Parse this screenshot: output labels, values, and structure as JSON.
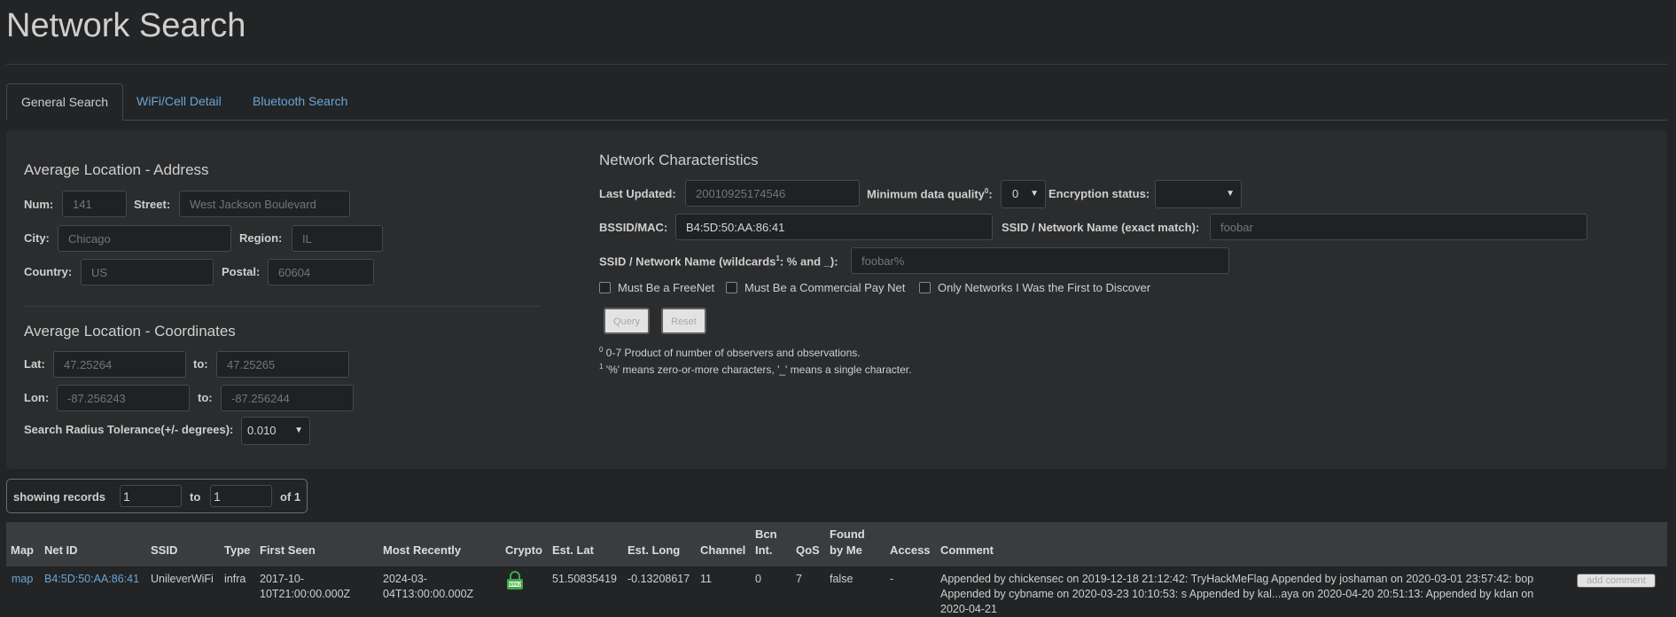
{
  "title": "Network Search",
  "tabs": [
    {
      "label": "General Search"
    },
    {
      "label": "WiFi/Cell Detail"
    },
    {
      "label": "Bluetooth Search"
    }
  ],
  "address": {
    "heading": "Average Location - Address",
    "num_label": "Num:",
    "num_placeholder": "141",
    "street_label": "Street:",
    "street_placeholder": "West Jackson Boulevard",
    "city_label": "City:",
    "city_placeholder": "Chicago",
    "region_label": "Region:",
    "region_placeholder": "IL",
    "country_label": "Country:",
    "country_placeholder": "US",
    "postal_label": "Postal:",
    "postal_placeholder": "60604"
  },
  "coords": {
    "heading": "Average Location - Coordinates",
    "lat_label": "Lat:",
    "lat_from": "47.25264",
    "to_label": "to:",
    "lat_to": "47.25265",
    "lon_label": "Lon:",
    "lon_from": "-87.256243",
    "lon_to": "-87.256244",
    "radius_label": "Search Radius Tolerance(+/- degrees):",
    "radius_value": "0.010"
  },
  "network": {
    "heading": "Network Characteristics",
    "last_updated_label": "Last Updated:",
    "last_updated_placeholder": "20010925174546",
    "min_quality_label": "Minimum data quality",
    "min_quality_sup": "0",
    "min_quality_value": "0",
    "encryption_label": "Encryption status:",
    "encryption_value": "",
    "bssid_label": "BSSID/MAC:",
    "bssid_value": "B4:5D:50:AA:86:41",
    "ssid_exact_label": "SSID / Network Name (exact match):",
    "ssid_exact_placeholder": "foobar",
    "ssid_wild_label_a": "SSID / Network Name (wildcards",
    "ssid_wild_sup": "1",
    "ssid_wild_label_b": ": % and _):",
    "ssid_wild_placeholder": "foobar%",
    "chk_freenet": "Must Be a FreeNet",
    "chk_paynet": "Must Be a Commercial Pay Net",
    "chk_first": "Only Networks I Was the First to Discover",
    "query_label": "Query",
    "reset_label": "Reset",
    "note0_sup": "0",
    "note0": " 0-7 Product of number of observers and observations.",
    "note1_sup": "1",
    "note1": " '%' means zero-or-more characters, '_' means a single character."
  },
  "records": {
    "showing_label": "showing records",
    "from": "1",
    "to_label": "to",
    "to": "1",
    "of_label": "of 1"
  },
  "table": {
    "headers": {
      "map": "Map",
      "netid": "Net ID",
      "ssid": "SSID",
      "type": "Type",
      "first_seen": "First Seen",
      "most_recently": "Most Recently",
      "crypto": "Crypto",
      "est_lat": "Est. Lat",
      "est_long": "Est. Long",
      "channel": "Channel",
      "bcn_a": "Bcn",
      "bcn_b": "Int.",
      "qos": "QoS",
      "found_a": "Found",
      "found_b": "by Me",
      "access": "Access",
      "comment": "Comment"
    },
    "row": {
      "map": "map",
      "netid": "B4:5D:50:AA:86:41",
      "ssid": "UnileverWiFi",
      "type": "infra",
      "first_seen_a": "2017-10-",
      "first_seen_b": "10T21:00:00.000Z",
      "most_recent_a": "2024-03-",
      "most_recent_b": "04T13:00:00.000Z",
      "crypto_icon": "lock-wpa-icon",
      "est_lat": "51.50835419",
      "est_long": "-0.13208617",
      "channel": "11",
      "bcn": "0",
      "qos": "7",
      "found": "false",
      "access": "-",
      "comment_1": "Appended by chickensec on 2019-12-18 21:12:42: TryHackMeFlag Appended by joshaman on 2020-03-01 23:57:42: bop",
      "comment_2": "Appended by cybname on 2020-03-23 10:10:53: s Appended by kal...aya on 2020-04-20 20:51:13: Appended by kdan on",
      "comment_3": "2020-04-21",
      "add_comment": "add comment"
    }
  }
}
